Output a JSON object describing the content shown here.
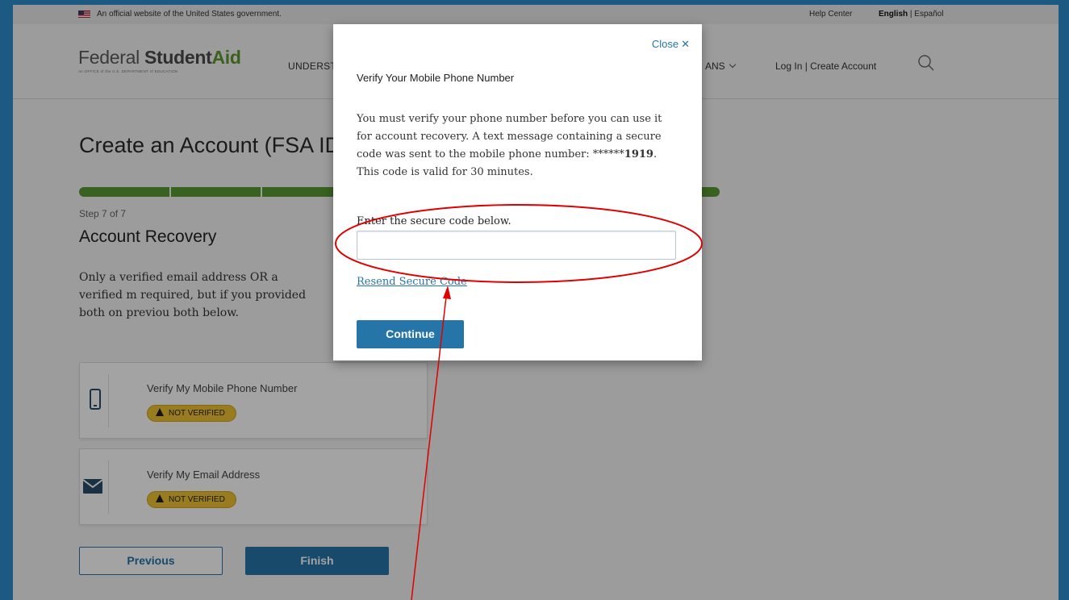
{
  "gov_banner": {
    "official_text": "An official website of the United States government.",
    "help_center": "Help Center",
    "lang_english": "English",
    "lang_separator": " | ",
    "lang_espanol": "Español"
  },
  "header": {
    "logo_federal": "Federal ",
    "logo_student": "Student",
    "logo_aid": "Aid",
    "logo_tagline": "An OFFICE of the U.S. DEPARTMENT of EDUCATION",
    "nav_partial_left": "UNDERSTA",
    "nav_partial_right": "ANS",
    "login": "Log In",
    "login_separator": " | ",
    "create_account": "Create Account"
  },
  "page": {
    "title": "Create an Account (FSA ID)",
    "progress": {
      "steps_total": 7,
      "steps_completed": 7
    },
    "step_label": "Step 7 of 7",
    "section_title": "Account Recovery",
    "intro": "Only a verified email address OR a verified m required, but if you provided both on previou both below."
  },
  "cards": [
    {
      "title": "Verify My Mobile Phone Number",
      "badge": "NOT VERIFIED",
      "icon": "mobile-phone-icon"
    },
    {
      "title": "Verify My Email Address",
      "badge": "NOT VERIFIED",
      "icon": "envelope-icon"
    }
  ],
  "buttons": {
    "previous": "Previous",
    "finish": "Finish"
  },
  "modal": {
    "close_label": "Close",
    "close_glyph": "✕",
    "title": "Verify Your Mobile Phone Number",
    "body_before": "You must verify your phone number before you can use it for account recovery. A text message containing a secure code was sent to the mobile phone number: ******",
    "body_phone_suffix": "1919",
    "body_after": ". This code is valid for 30 minutes.",
    "code_label": "Enter the secure code below.",
    "code_value": "",
    "resend_link": "Resend Secure Code",
    "continue_button": "Continue"
  },
  "colors": {
    "brand_blue": "#2575a8",
    "progress_green": "#5a9a32",
    "badge_yellow": "#f1c232",
    "annotation_red": "#e00000",
    "outer_frame": "#1d5a83"
  }
}
